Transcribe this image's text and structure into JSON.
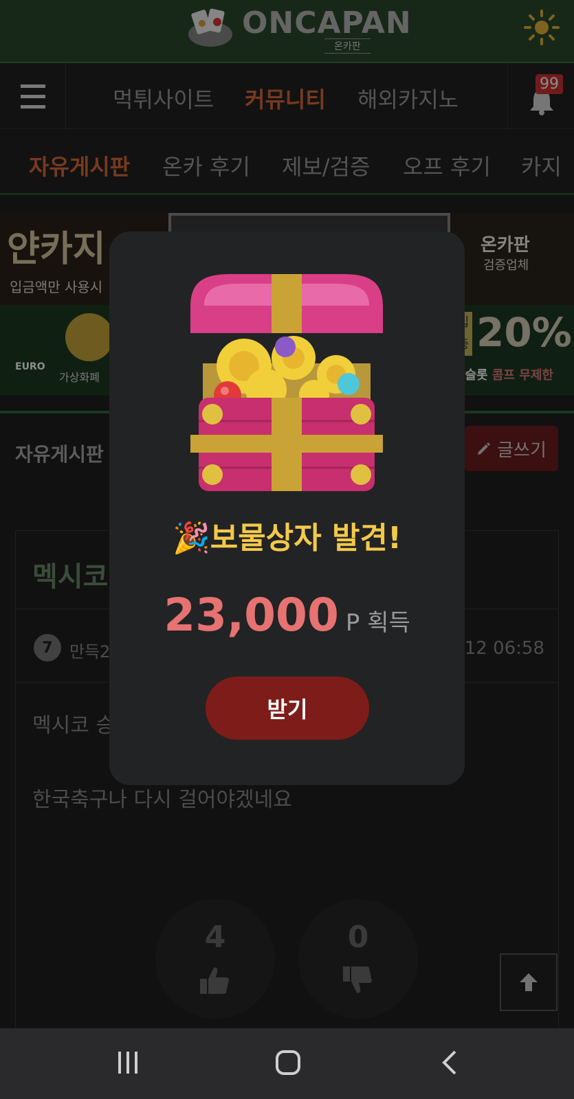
{
  "header": {
    "logo_text": "ONCAPAN",
    "logo_sub": "온카판",
    "theme_icon": "sun-icon"
  },
  "main_nav": {
    "menu_icon": "hamburger-icon",
    "items": [
      {
        "label": "먹튀사이트",
        "active": false
      },
      {
        "label": "커뮤니티",
        "active": true
      },
      {
        "label": "해외카지노",
        "active": false
      }
    ],
    "notifications_badge": "99"
  },
  "sub_nav": {
    "items": [
      {
        "label": "자유게시판",
        "active": true
      },
      {
        "label": "온카 후기",
        "active": false
      },
      {
        "label": "제보/검증",
        "active": false
      },
      {
        "label": "오프 후기",
        "active": false
      },
      {
        "label": "카지",
        "active": false
      }
    ]
  },
  "banners": {
    "banner1_left": "얀카지",
    "banner1_left_sub": "입금액만 사용시",
    "banner1_right": "온카판",
    "banner1_right_sub": "검증업체",
    "banner2_left": "EURO",
    "banner2_left_sub": "가상화폐",
    "banner2_right_small1": "입",
    "banner2_right_small2": "충",
    "banner2_right_big": "20%",
    "banner2_right_sub": ": 슬롯",
    "banner2_right_sub2": "콤프 무제한"
  },
  "board": {
    "title": "자유게시판",
    "write_button": "글쓰기",
    "post": {
      "title": "멕시코",
      "level": "7",
      "author": "만득2",
      "date": "6-12 06:58",
      "body_line1": "멕시코 승",
      "body_line2": "한국축구나 다시 걸어야겠네요",
      "likes": "4",
      "dislikes": "0"
    }
  },
  "modal": {
    "title": "🎉보물상자 발견!",
    "amount": "23,000",
    "unit": "P 획득",
    "claim_button": "받기"
  },
  "colors": {
    "header_green": "#2a4a2c",
    "accent_orange": "#d86a3a",
    "modal_title": "#f3c94a",
    "reward_amount": "#e67272",
    "claim_button": "#7e1c1a"
  }
}
